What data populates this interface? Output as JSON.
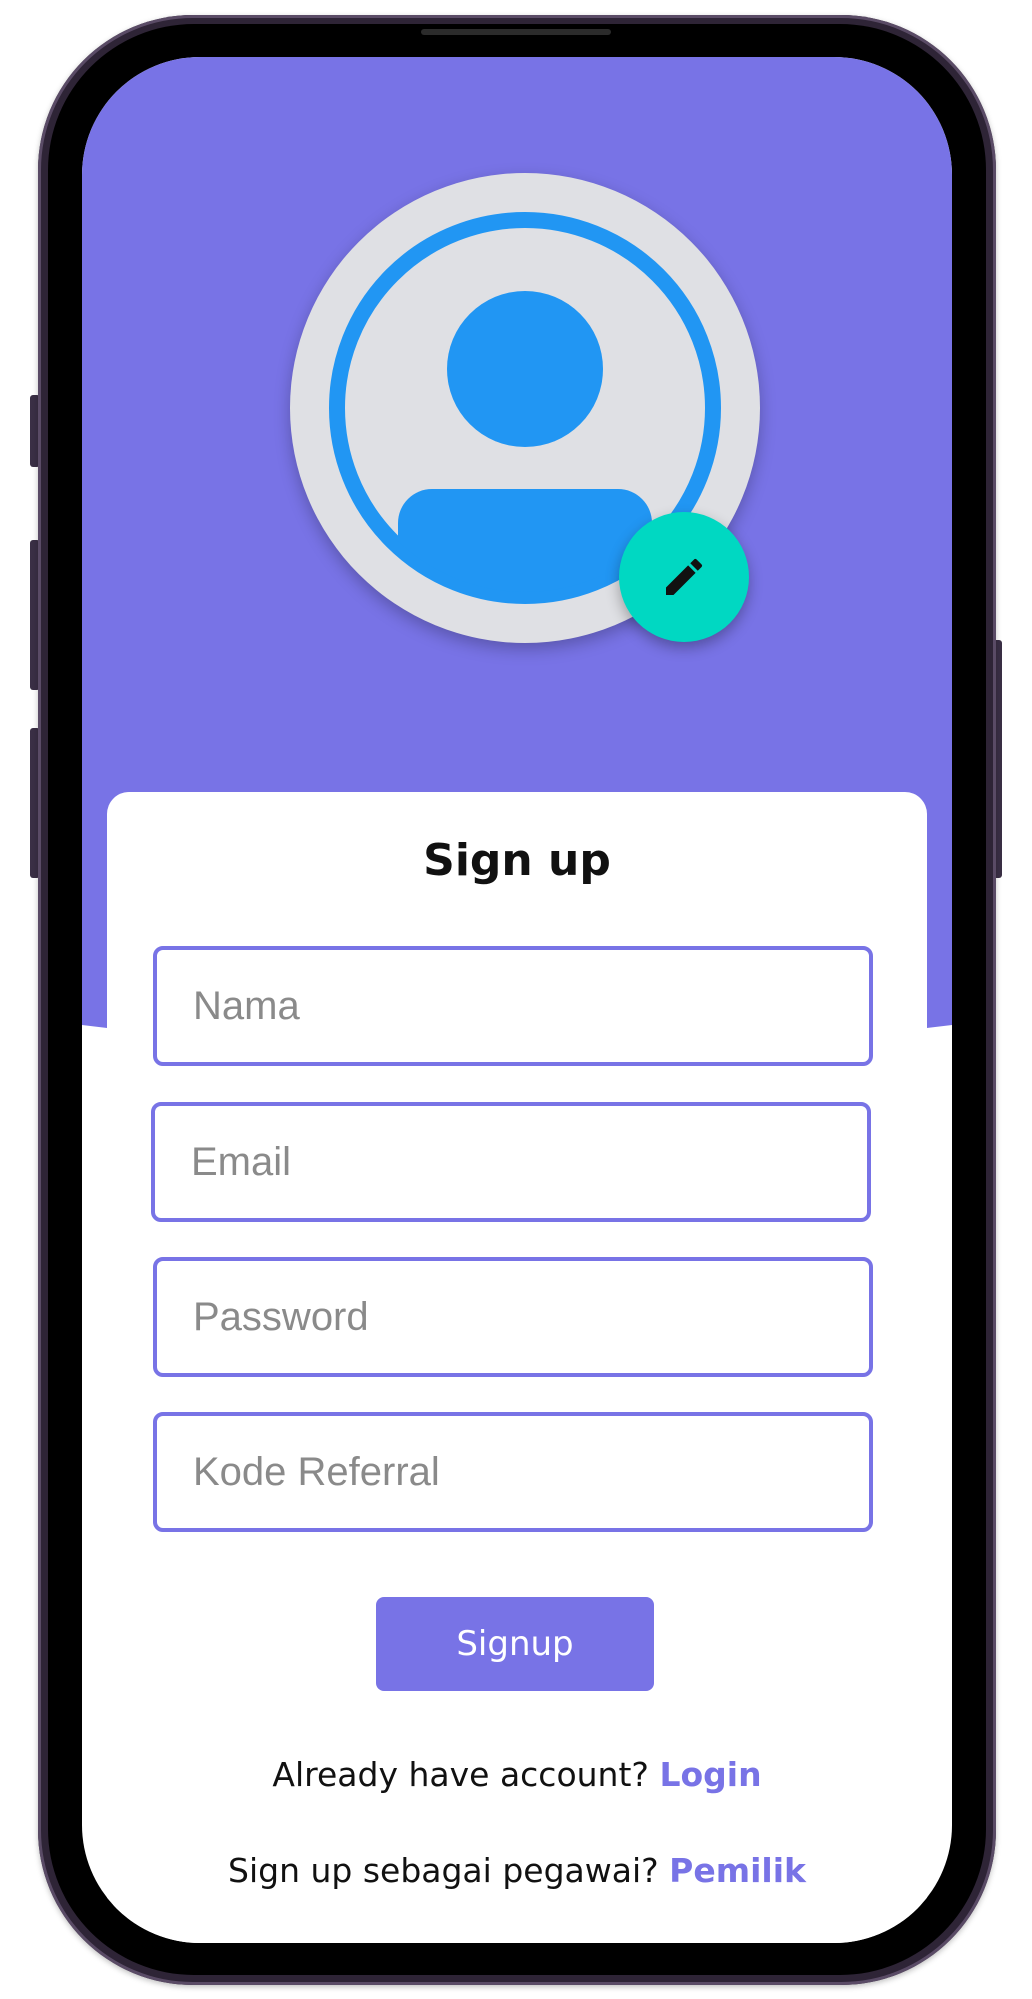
{
  "signup": {
    "title": "Sign up",
    "fields": [
      {
        "placeholder": "Nama",
        "value": ""
      },
      {
        "placeholder": "Email",
        "value": ""
      },
      {
        "placeholder": "Password",
        "value": ""
      },
      {
        "placeholder": "Kode Referral",
        "value": ""
      }
    ],
    "button_label": "Signup",
    "login_prompt": "Already have account?",
    "login_link": "Login",
    "owner_prompt": "Sign up sebagai pegawai?",
    "owner_link": "Pemilik"
  },
  "icons": {
    "avatar": "account-circle-icon",
    "edit": "pencil-icon"
  },
  "colors": {
    "primary": "#7873e6",
    "avatar_blue": "#2196f3",
    "avatar_bg": "#dfe0e4",
    "fab": "#00d8c2"
  }
}
